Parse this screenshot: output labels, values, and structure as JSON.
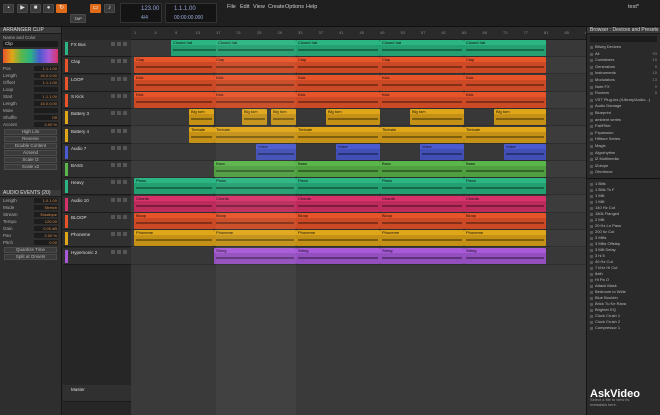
{
  "transport": {
    "tempo": "123.00",
    "sig": "4/4",
    "position": "1.1.1.00",
    "time": "00:00:00.000",
    "tap": "TAP",
    "play_mode": "1.1"
  },
  "menus": [
    "File",
    "Edit",
    "View",
    "Create",
    "Options",
    "Help"
  ],
  "window_title": "test*",
  "left_panel": {
    "clip_header": "ARRANGER CLIP",
    "name_label": "Name and Color",
    "clip_name": "Clip",
    "params": [
      {
        "l": "Pos",
        "v": "1.1.1.00"
      },
      {
        "l": "Length",
        "v": "16.0.0.00"
      },
      {
        "l": "Offset",
        "v": "1.1.1.00"
      },
      {
        "l": "Loop",
        "v": ""
      },
      {
        "l": "Start",
        "v": "1.1.1.00"
      },
      {
        "l": "Length",
        "v": "16.0.0.00"
      },
      {
        "l": "Mute",
        "v": ""
      },
      {
        "l": "Shuffle",
        "v": "Off"
      },
      {
        "l": "Accent",
        "v": "0.00 %"
      }
    ],
    "buttons": [
      "High Lim",
      "Reverse",
      "Double Content",
      "Acsend",
      "Scale /2",
      "Scale x2"
    ],
    "events_header": "AUDIO EVENTS (20)",
    "events": [
      {
        "l": "Length",
        "v": "1.0.1.00"
      },
      {
        "l": "Mode",
        "v": "Stretch"
      },
      {
        "l": "Stream",
        "v": "Elastique"
      },
      {
        "l": "Tempo",
        "v": "120.00"
      },
      {
        "l": "Gain",
        "v": "0.00 dB"
      },
      {
        "l": "Pan",
        "v": "0.00 %"
      },
      {
        "l": "Pitch",
        "v": "0.00"
      }
    ],
    "events_buttons": [
      "Quantize Time",
      "Split at Onsets"
    ]
  },
  "tracks": [
    {
      "name": "FX Bus",
      "color": "#2ab582"
    },
    {
      "name": "Clap",
      "color": "#e8542a"
    },
    {
      "name": "LOOP",
      "color": "#e8542a"
    },
    {
      "name": "S Kick",
      "color": "#e8542a"
    },
    {
      "name": "Battery 3",
      "color": "#e0a61a"
    },
    {
      "name": "Battery 4",
      "color": "#e0a61a"
    },
    {
      "name": "Audio 7",
      "color": "#4a5ad0"
    },
    {
      "name": "BASS",
      "color": "#5ab54a"
    },
    {
      "name": "Heavy",
      "color": "#2ab582"
    },
    {
      "name": "Audio 10",
      "color": "#d8326a"
    },
    {
      "name": "BLOOP",
      "color": "#e8542a"
    },
    {
      "name": "Phoneme",
      "color": "#e0a61a"
    },
    {
      "name": "Hypersonic 2",
      "color": "#a85ad8"
    }
  ],
  "master_track": "Master",
  "ruler": [
    "1",
    "5",
    "9",
    "13",
    "17",
    "21",
    "25",
    "29",
    "33",
    "37",
    "41",
    "45",
    "49",
    "53",
    "57",
    "61",
    "65",
    "69",
    "73",
    "77",
    "81",
    "85",
    "89"
  ],
  "lanes": [
    [
      {
        "n": "Closed hat",
        "s": 40,
        "w": 50
      },
      {
        "n": "Closed hat",
        "s": 85,
        "w": 80
      },
      {
        "n": "Closed hat",
        "s": 165,
        "w": 84
      },
      {
        "n": "Closed hat",
        "s": 249,
        "w": 84
      },
      {
        "n": "Closed hat",
        "s": 333,
        "w": 82
      }
    ],
    [
      {
        "n": "Clap",
        "s": 3,
        "w": 80
      },
      {
        "n": "Clap",
        "s": 83,
        "w": 82
      },
      {
        "n": "Clap",
        "s": 165,
        "w": 84
      },
      {
        "n": "Clap",
        "s": 249,
        "w": 84
      },
      {
        "n": "Clap",
        "s": 333,
        "w": 82
      }
    ],
    [
      {
        "n": "Kick",
        "s": 3,
        "w": 80
      },
      {
        "n": "Kick",
        "s": 83,
        "w": 82
      },
      {
        "n": "Kick",
        "s": 165,
        "w": 84
      },
      {
        "n": "Kick",
        "s": 249,
        "w": 84
      },
      {
        "n": "Kick",
        "s": 333,
        "w": 82
      }
    ],
    [
      {
        "n": "Kick",
        "s": 3,
        "w": 80
      },
      {
        "n": "Kick",
        "s": 83,
        "w": 82
      },
      {
        "n": "Kick",
        "s": 165,
        "w": 84
      },
      {
        "n": "Kick",
        "s": 249,
        "w": 84
      },
      {
        "n": "Kick",
        "s": 333,
        "w": 82
      }
    ],
    [
      {
        "n": "Big tom",
        "s": 58,
        "w": 25
      },
      {
        "n": "Big tom",
        "s": 111,
        "w": 25
      },
      {
        "n": "Big tom",
        "s": 140,
        "w": 25
      },
      {
        "n": "Big tom",
        "s": 195,
        "w": 54
      },
      {
        "n": "Big tom",
        "s": 279,
        "w": 54
      },
      {
        "n": "Big tom",
        "s": 363,
        "w": 52
      }
    ],
    [
      {
        "n": "Timbale",
        "s": 58,
        "w": 25
      },
      {
        "n": "Timbale",
        "s": 83,
        "w": 82
      },
      {
        "n": "Timbale",
        "s": 165,
        "w": 84
      },
      {
        "n": "Timbale",
        "s": 249,
        "w": 84
      },
      {
        "n": "Timbale",
        "s": 333,
        "w": 82
      }
    ],
    [
      {
        "n": "Voice",
        "s": 125,
        "w": 40
      },
      {
        "n": "Voice",
        "s": 205,
        "w": 44
      },
      {
        "n": "Voice",
        "s": 289,
        "w": 44
      },
      {
        "n": "Voice",
        "s": 373,
        "w": 42
      }
    ],
    [
      {
        "n": "Bass",
        "s": 83,
        "w": 82
      },
      {
        "n": "Bass",
        "s": 165,
        "w": 84
      },
      {
        "n": "Bass",
        "s": 249,
        "w": 84
      },
      {
        "n": "Bass",
        "s": 333,
        "w": 82
      }
    ],
    [
      {
        "n": "Piano",
        "s": 3,
        "w": 80
      },
      {
        "n": "Piano",
        "s": 83,
        "w": 82
      },
      {
        "n": "Piano",
        "s": 165,
        "w": 84
      },
      {
        "n": "Piano",
        "s": 249,
        "w": 84
      },
      {
        "n": "Piano",
        "s": 333,
        "w": 82
      }
    ],
    [
      {
        "n": "Chords",
        "s": 3,
        "w": 80
      },
      {
        "n": "Chords",
        "s": 83,
        "w": 82
      },
      {
        "n": "Chords",
        "s": 165,
        "w": 84
      },
      {
        "n": "Chords",
        "s": 249,
        "w": 84
      },
      {
        "n": "Chords",
        "s": 333,
        "w": 82
      }
    ],
    [
      {
        "n": "Bloop",
        "s": 3,
        "w": 80
      },
      {
        "n": "Bloop",
        "s": 83,
        "w": 82
      },
      {
        "n": "Bloop",
        "s": 165,
        "w": 84
      },
      {
        "n": "Bloop",
        "s": 249,
        "w": 84
      },
      {
        "n": "Bloop",
        "s": 333,
        "w": 82
      }
    ],
    [
      {
        "n": "Phoneme",
        "s": 3,
        "w": 80
      },
      {
        "n": "Phoneme",
        "s": 83,
        "w": 82
      },
      {
        "n": "Phoneme",
        "s": 165,
        "w": 84
      },
      {
        "n": "Phoneme",
        "s": 249,
        "w": 84
      },
      {
        "n": "Phoneme",
        "s": 333,
        "w": 82
      }
    ],
    [
      {
        "n": "String",
        "s": 83,
        "w": 82
      },
      {
        "n": "String",
        "s": 165,
        "w": 84
      },
      {
        "n": "String",
        "s": 249,
        "w": 84
      },
      {
        "n": "String",
        "s": 333,
        "w": 82
      }
    ]
  ],
  "browser": {
    "header": "Browser : Devices and Presets",
    "search": "",
    "categories": [
      {
        "n": "Bitwig Devices",
        "c": ""
      },
      {
        "n": "All",
        "c": "93"
      },
      {
        "n": "Containers",
        "c": "10"
      },
      {
        "n": "Generators",
        "c": "9"
      },
      {
        "n": "Instruments",
        "c": "15"
      },
      {
        "n": "Modulators",
        "c": "13"
      },
      {
        "n": "Note FX",
        "c": "9"
      },
      {
        "n": "Routers",
        "c": "5"
      },
      {
        "n": "VST Plug-ins (/Library/Audio...)",
        "c": ""
      },
      {
        "n": "Audio Damage",
        "c": ""
      },
      {
        "n": "Blueprint",
        "c": ""
      },
      {
        "n": "ambient series",
        "c": ""
      },
      {
        "n": "FabFilter",
        "c": ""
      },
      {
        "n": "Fxpansion",
        "c": ""
      },
      {
        "n": "Hifiture Series",
        "c": ""
      },
      {
        "n": "Magix",
        "c": ""
      },
      {
        "n": "Algorhythm",
        "c": ""
      },
      {
        "n": "iZ Multimedia",
        "c": ""
      },
      {
        "n": "iZotope",
        "c": ""
      },
      {
        "n": "Ohmforce",
        "c": ""
      }
    ],
    "presets": [
      "1 Bills",
      "1 Bills To F",
      "1 Mill",
      "1 Mill",
      "140 Hz Cut",
      "180k Flanged",
      "2 Mill",
      "20 Hz Lo Pass",
      "200 hz Cut",
      "3 Mills",
      "3 Mills Offstep",
      "3 Mill Delay",
      "3 hi 5",
      "40 Hz Cut",
      "7 kHz Hi Cut",
      "8ath",
      "Hi Pa O",
      "Attack Mask",
      "Bedroom to Wide",
      "Blue Boulder",
      "Brick Tu Ke Rana",
      "Brighter EQ",
      "Clock Crush 1",
      "Clock Crush 2",
      "Compressor 1"
    ],
    "hint": "Select a file to view its metadata here."
  }
}
